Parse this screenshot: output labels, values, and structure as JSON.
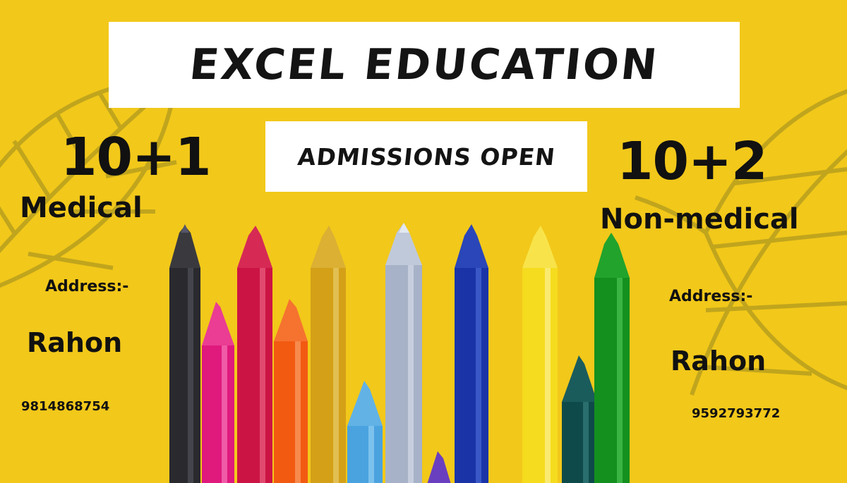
{
  "title": "EXCEL EDUCATION",
  "subtitle": "ADMISSIONS OPEN",
  "left": {
    "grade": "10+1",
    "stream": "Medical",
    "address_label": "Address:-",
    "place": "Rahon",
    "phone": "9814868754"
  },
  "right": {
    "grade": "10+2",
    "stream": "Non-medical",
    "address_label": "Address:-",
    "place": "Rahon",
    "phone": "9592793772"
  },
  "colors": {
    "background": "#f2c81a",
    "crayons": [
      "#2a2a2e",
      "#e0197d",
      "#cc1444",
      "#f25a12",
      "#d4a017",
      "#4aa3df",
      "#a7b2c8",
      "#1a34a8",
      "#f5dc1e",
      "#0f4a4a",
      "#14901e",
      "#6a3fbf"
    ]
  }
}
